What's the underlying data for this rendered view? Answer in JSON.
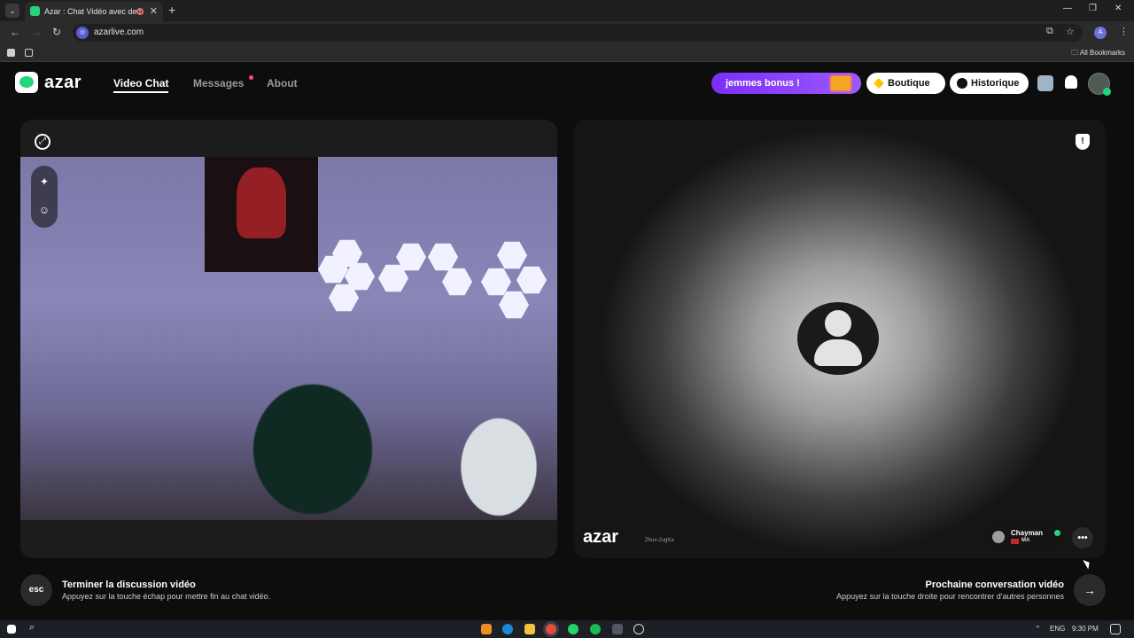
{
  "browser": {
    "tab_title": "Azar : Chat Vidéo avec de n",
    "url": "azarlive.com",
    "bookmarks_label": "All Bookmarks",
    "profile_initial": "A"
  },
  "header": {
    "logo": "azar",
    "nav": [
      "Video Chat",
      "Messages",
      "About"
    ],
    "bonus": "jemmes bonus !",
    "boutique": "Boutique",
    "historique": "Historique"
  },
  "peer": {
    "watermark": "azar",
    "session_id": "Zhuv-2ugKa",
    "name": "Chayman",
    "country": "MA"
  },
  "controls": {
    "esc_key": "esc",
    "end_title": "Terminer la discussion vidéo",
    "end_sub": "Appuyez sur la touche échap pour mettre fin au chat vidéo.",
    "next_title": "Prochaine conversation vidéo",
    "next_sub": "Appuyez sur la touche droite pour rencontrer d'autres personnes"
  },
  "taskbar": {
    "lang": "ENG",
    "time": "9:30 PM"
  },
  "colors": {
    "brand_green": "#22d67a",
    "bonus_purple": "#7b2ff7"
  }
}
